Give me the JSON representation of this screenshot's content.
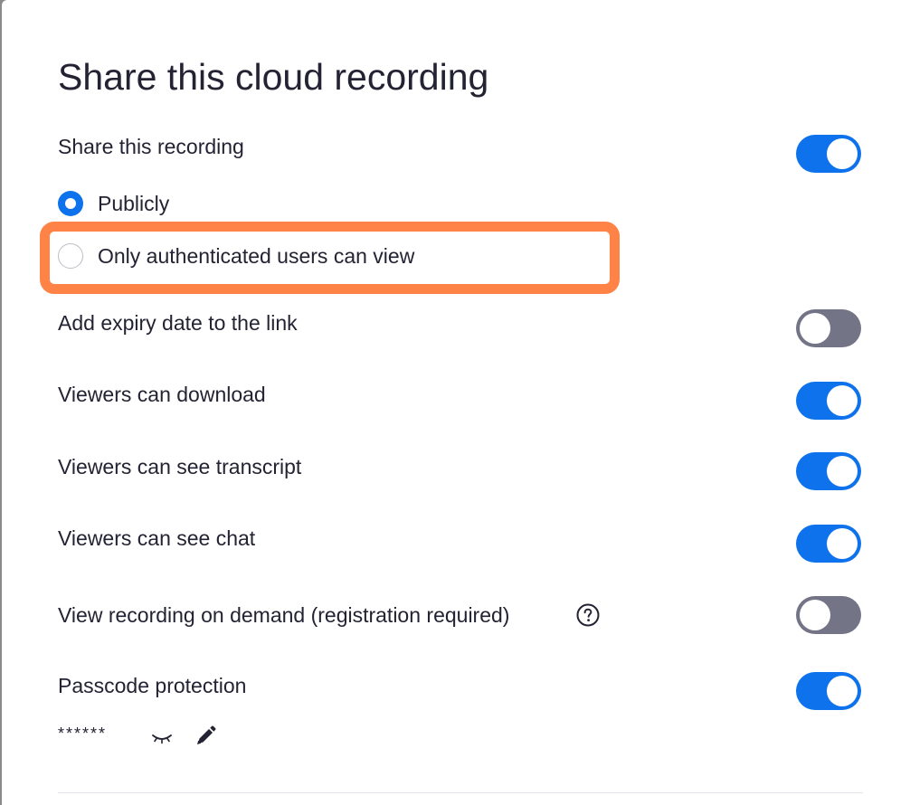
{
  "dialog": {
    "title": "Share this cloud recording"
  },
  "share": {
    "label": "Share this recording",
    "enabled": true,
    "options": [
      {
        "label": "Publicly",
        "selected": true
      },
      {
        "label": "Only authenticated users can view",
        "selected": false
      }
    ]
  },
  "settings": [
    {
      "label": "Add expiry date to the link",
      "enabled": false
    },
    {
      "label": "Viewers can download",
      "enabled": true
    },
    {
      "label": "Viewers can see transcript",
      "enabled": true
    },
    {
      "label": "Viewers can see chat",
      "enabled": true
    },
    {
      "label": "View recording on demand (registration required)",
      "enabled": false,
      "icon": "question-circle-icon"
    },
    {
      "label": "Passcode protection",
      "enabled": true
    }
  ],
  "passcode": {
    "masked_value": "******",
    "reveal_icon": "eye-closed-icon",
    "edit_icon": "pencil-icon"
  },
  "colors": {
    "toggle_on": "#0e72ed",
    "toggle_off": "#747487",
    "highlight": "#ff8347",
    "text": "#232333"
  }
}
